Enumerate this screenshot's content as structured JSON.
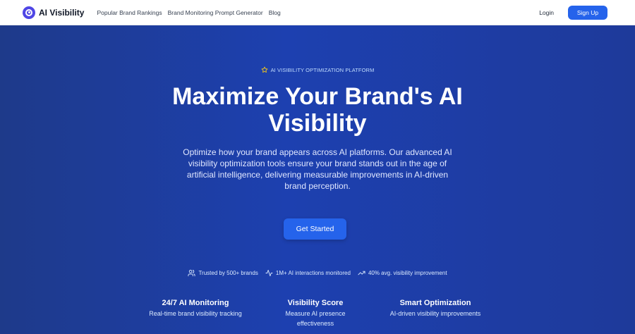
{
  "nav": {
    "logo_text": "AI Visibility",
    "links": [
      "Popular Brand Rankings",
      "Brand Monitoring Prompt Generator",
      "Blog"
    ],
    "login": "Login",
    "signup": "Sign Up"
  },
  "hero": {
    "badge": "AI VISIBILITY OPTIMIZATION PLATFORM",
    "title_line1": "Maximize Your Brand's AI",
    "title_line2": "Visibility",
    "description": "Optimize how your brand appears across AI platforms. Our advanced AI visibility optimization tools ensure your brand stands out in the age of artificial intelligence, delivering measurable improvements in AI-driven brand perception.",
    "cta": "Get Started"
  },
  "stats": [
    {
      "icon": "users-icon",
      "text": "Trusted by 500+ brands"
    },
    {
      "icon": "activity-icon",
      "text": "1M+ AI interactions monitored"
    },
    {
      "icon": "trending-up-icon",
      "text": "40% avg. visibility improvement"
    }
  ],
  "features": [
    {
      "title": "24/7 AI Monitoring",
      "desc": "Real-time brand visibility tracking"
    },
    {
      "title": "Visibility Score",
      "desc": "Measure AI presence effectiveness"
    },
    {
      "title": "Smart Optimization",
      "desc": "AI-driven visibility improvements"
    }
  ],
  "colors": {
    "brand": "#4f46e5",
    "primary_button": "#2563eb",
    "hero_bg": "#1e3a9e",
    "badge_star": "#facc15"
  }
}
